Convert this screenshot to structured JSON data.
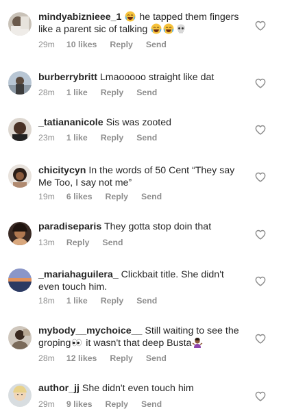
{
  "comments": [
    {
      "user": "mindyabiznieee_1",
      "text_a": "he tapped them fingers like a parent sic of talking",
      "time": "29m",
      "likes": "10 likes",
      "reply": "Reply",
      "send": "Send"
    },
    {
      "user": "burberrybritt",
      "text_a": "Lmaooooo straight like dat",
      "time": "28m",
      "likes": "1 like",
      "reply": "Reply",
      "send": "Send"
    },
    {
      "user": "_tatiananicole",
      "text_a": "Sis was zooted",
      "time": "23m",
      "likes": "1 like",
      "reply": "Reply",
      "send": "Send"
    },
    {
      "user": "chicitycyn",
      "text_a": "In the words of 50 Cent “They say Me Too, I say not me”",
      "time": "19m",
      "likes": "6 likes",
      "reply": "Reply",
      "send": "Send"
    },
    {
      "user": "paradiseparis",
      "text_a": "They gotta stop doin that",
      "time": "13m",
      "likes": "",
      "reply": "Reply",
      "send": "Send"
    },
    {
      "user": "_mariahaguilera_",
      "text_a": "Clickbait title. She didn't even touch him.",
      "time": "18m",
      "likes": "1 like",
      "reply": "Reply",
      "send": "Send"
    },
    {
      "user": "mybody__mychoice__",
      "text_a": "Still waiting to see the groping",
      "text_b": "it wasn't that deep Busta",
      "time": "28m",
      "likes": "12 likes",
      "reply": "Reply",
      "send": "Send"
    },
    {
      "user": "author_jj",
      "text_a": "She didn't even touch him",
      "time": "29m",
      "likes": "9 likes",
      "reply": "Reply",
      "send": "Send"
    }
  ],
  "colors": {
    "text": "#262626",
    "meta": "#8e8e8e",
    "heart": "#8e8e8e"
  },
  "icons": {
    "like": "heart-outline-icon",
    "laugh": "face-with-tears-of-joy-emoji",
    "skull": "skull-emoji",
    "eyes": "eyes-emoji",
    "shrug": "woman-shrugging-emoji"
  }
}
